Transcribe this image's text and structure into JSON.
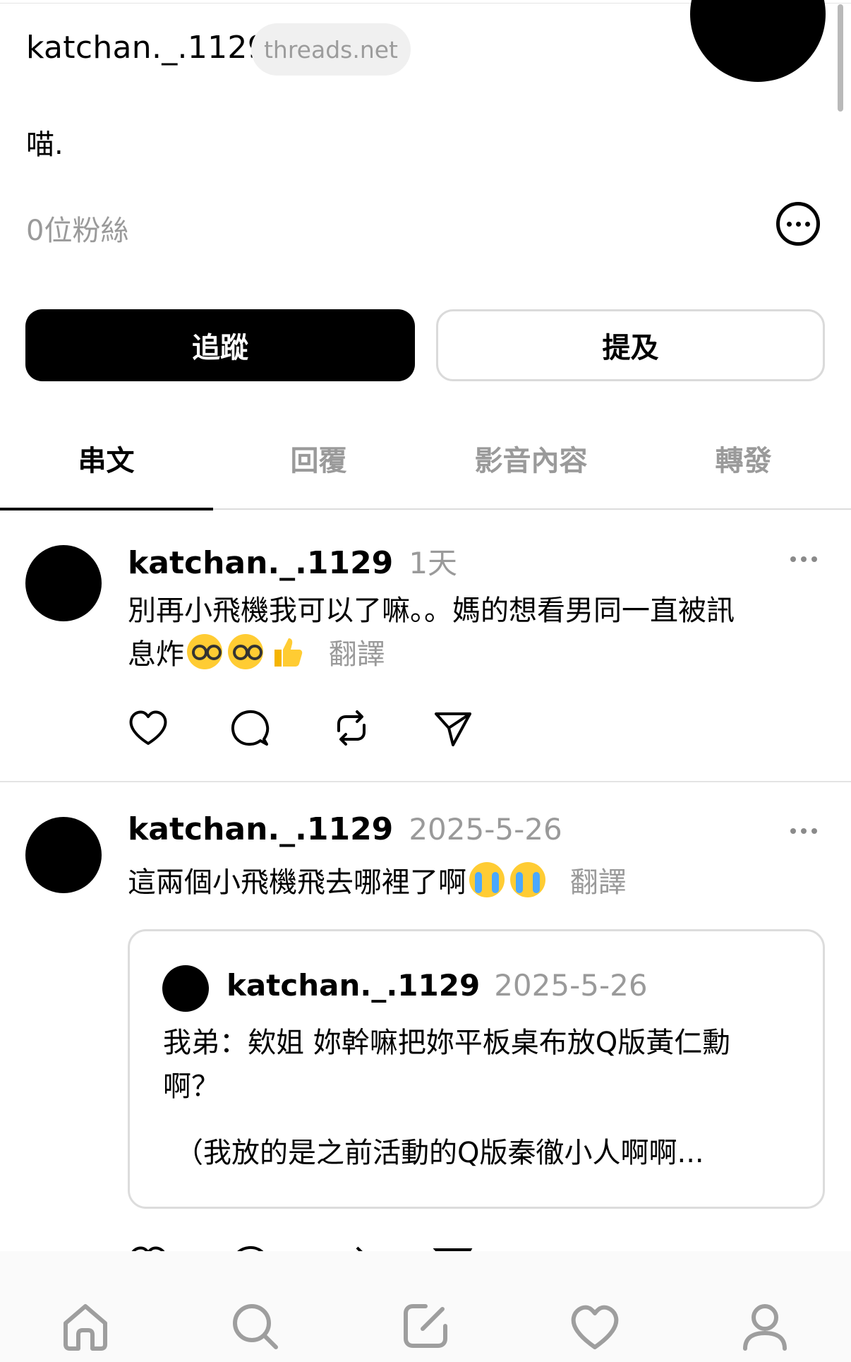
{
  "profile": {
    "username": "katchan._.1129",
    "domain_badge": "threads.net",
    "bio": "喵.",
    "followers": "0位粉絲"
  },
  "buttons": {
    "follow": "追蹤",
    "mention": "提及"
  },
  "tabs": [
    {
      "label": "串文",
      "active": true
    },
    {
      "label": "回覆",
      "active": false
    },
    {
      "label": "影音內容",
      "active": false
    },
    {
      "label": "轉發",
      "active": false
    }
  ],
  "posts": [
    {
      "user": "katchan._.1129",
      "time": "1天",
      "text_line1": "別再小飛機我可以了嘛。。媽的想看男同一直被訊",
      "text_line2": "息炸",
      "translate": "翻譯"
    },
    {
      "user": "katchan._.1129",
      "time": "2025-5-26",
      "text": "這兩個小飛機飛去哪裡了啊",
      "translate": "翻譯",
      "quote": {
        "user": "katchan._.1129",
        "time": "2025-5-26",
        "line1": "我弟：欸姐 妳幹嘛把妳平板桌布放Q版黃仁勳",
        "line2": "啊？",
        "line3": "（我放的是之前活動的Q版秦徹小人啊啊..."
      }
    }
  ],
  "icons": {
    "more": "more-circle-icon",
    "like": "heart-icon",
    "reply": "comment-icon",
    "repost": "repost-icon",
    "share": "send-icon",
    "nav": [
      "home-icon",
      "search-icon",
      "compose-icon",
      "activity-heart-icon",
      "profile-icon"
    ]
  }
}
